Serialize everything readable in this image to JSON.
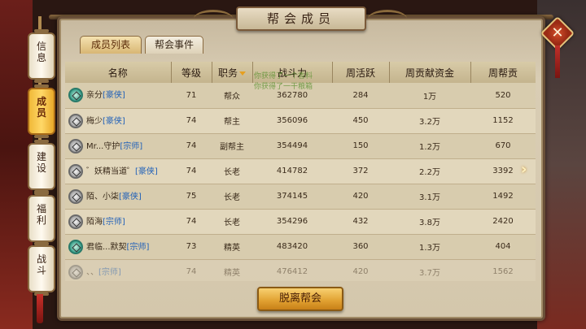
{
  "window": {
    "title": "帮会成员"
  },
  "side_tabs": [
    {
      "label": "信息",
      "active": false
    },
    {
      "label": "成员",
      "active": true
    },
    {
      "label": "建设",
      "active": false
    },
    {
      "label": "福利",
      "active": false
    },
    {
      "label": "战斗",
      "active": false
    }
  ],
  "sub_tabs": {
    "members": "成员列表",
    "events": "帮会事件"
  },
  "table": {
    "headers": [
      "名称",
      "等级",
      "职务",
      "战斗力",
      "周活跃",
      "周贡献资金",
      "周帮贡"
    ],
    "rows": [
      {
        "name": "亲分",
        "tag": "[豪侠]",
        "level": "71",
        "role": "帮众",
        "power": "362780",
        "activity": "284",
        "funds": "1万",
        "contrib": "520"
      },
      {
        "name": "梅少",
        "tag": "[豪侠]",
        "level": "74",
        "role": "帮主",
        "power": "356096",
        "activity": "450",
        "funds": "3.2万",
        "contrib": "1152"
      },
      {
        "name": "Mr...守护",
        "tag": "[宗师]",
        "level": "74",
        "role": "副帮主",
        "power": "354494",
        "activity": "150",
        "funds": "1.2万",
        "contrib": "670"
      },
      {
        "name": "゛妖精当道゜",
        "tag": "[豪侠]",
        "level": "74",
        "role": "长老",
        "power": "414782",
        "activity": "372",
        "funds": "2.2万",
        "contrib": "3392"
      },
      {
        "name": "陌、小柒",
        "tag": "[豪侠]",
        "level": "75",
        "role": "长老",
        "power": "374145",
        "activity": "420",
        "funds": "3.1万",
        "contrib": "1492"
      },
      {
        "name": "陌海",
        "tag": "[宗师]",
        "level": "74",
        "role": "长老",
        "power": "354296",
        "activity": "432",
        "funds": "3.8万",
        "contrib": "2420"
      },
      {
        "name": "君临...默契",
        "tag": "[宗师]",
        "level": "73",
        "role": "精英",
        "power": "483420",
        "activity": "360",
        "funds": "1.3万",
        "contrib": "404"
      },
      {
        "name": "、、",
        "tag": "[宗师]",
        "level": "74",
        "role": "精英",
        "power": "476412",
        "activity": "420",
        "funds": "3.7万",
        "contrib": "1562"
      }
    ]
  },
  "float_text": {
    "line1": "你获得了一个香料",
    "line2": "你获得了一干粮箱"
  },
  "leave_button": "脱离帮会",
  "colors": {
    "accent": "#e0a030",
    "tag_blue": "#2060b8",
    "panel_bg": "#d4c7ac"
  }
}
